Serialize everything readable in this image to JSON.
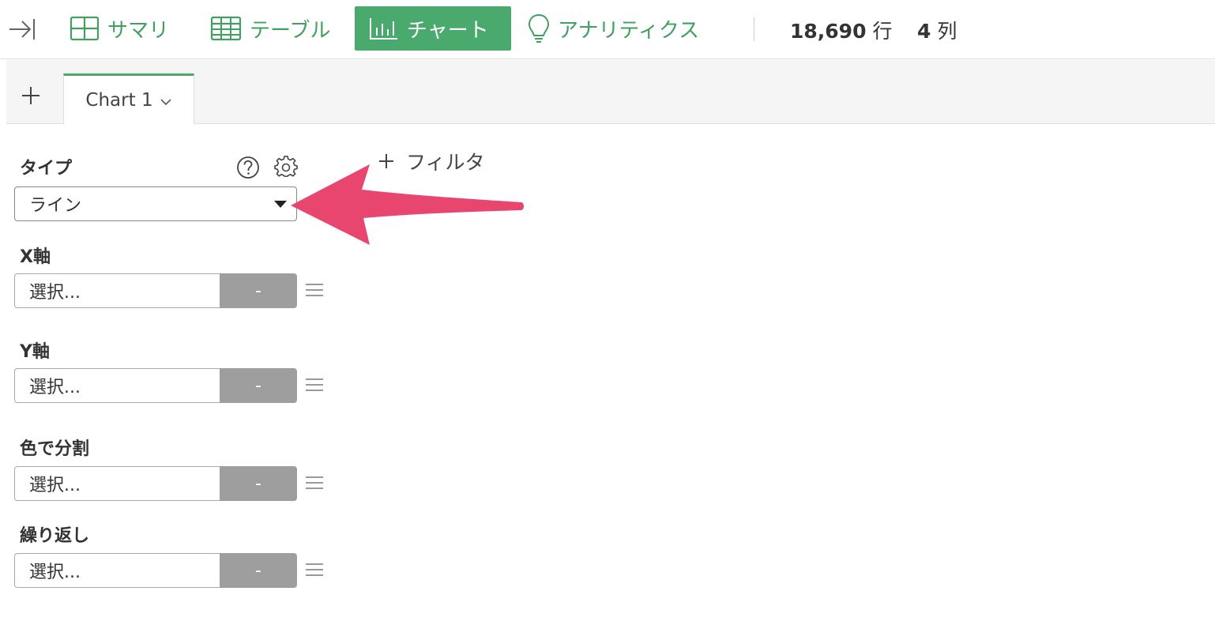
{
  "toolbar": {
    "summary_label": "サマリ",
    "table_label": "テーブル",
    "chart_label": "チャート",
    "analytics_label": "アナリティクス",
    "rows_value": "18,690",
    "rows_unit": "行",
    "cols_value": "4",
    "cols_unit": "列",
    "accent_color": "#4aa96c"
  },
  "tabs": {
    "add_icon": "plus-icon",
    "items": [
      {
        "label": "Chart 1"
      }
    ]
  },
  "panel": {
    "type_label": "タイプ",
    "type_value": "ライン",
    "filter_label": "フィルタ",
    "fields": [
      {
        "label": "X軸",
        "placeholder": "選択...",
        "agg": "-"
      },
      {
        "label": "Y軸",
        "placeholder": "選択...",
        "agg": "-"
      },
      {
        "label": "色で分割",
        "placeholder": "選択...",
        "agg": "-"
      },
      {
        "label": "繰り返し",
        "placeholder": "選択...",
        "agg": "-"
      }
    ]
  },
  "annotation": {
    "arrow_color": "#e8466e"
  }
}
